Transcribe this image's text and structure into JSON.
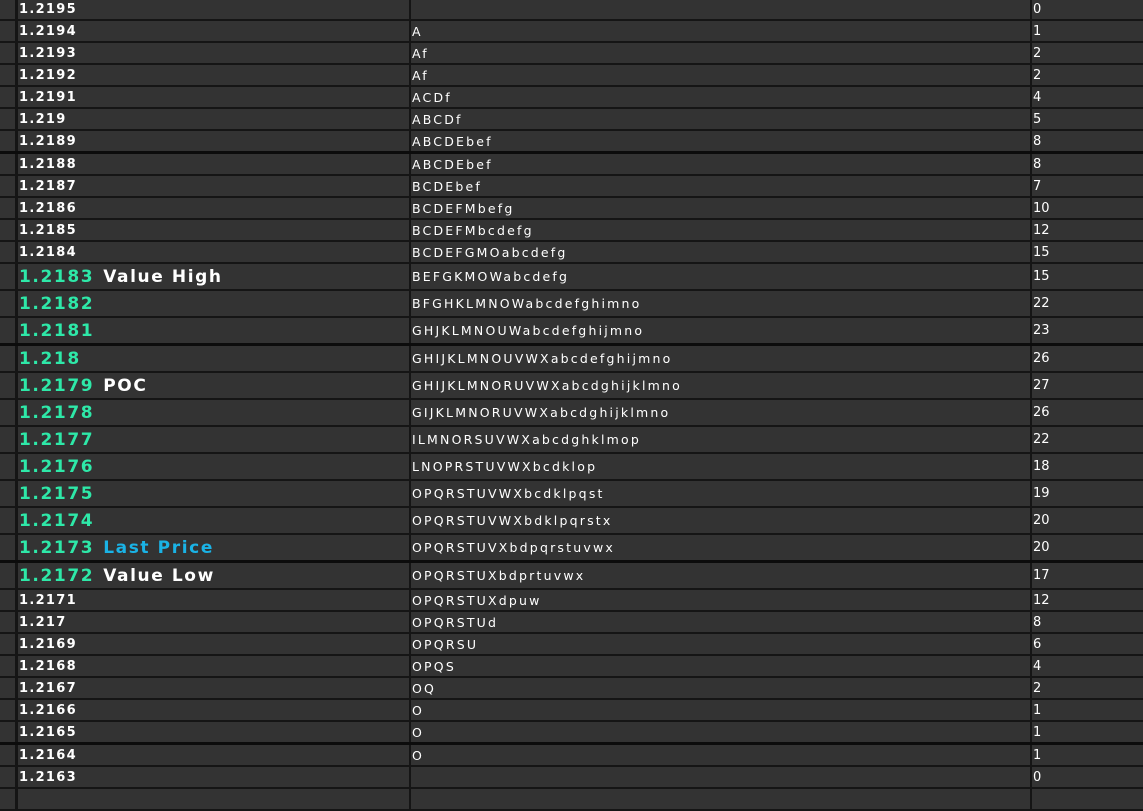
{
  "colors": {
    "background": "#333333",
    "grid": "#151515",
    "highlight_price": "#2ee8a8",
    "last_price_label": "#1ab3e6",
    "text": "#ffffff"
  },
  "rows": [
    {
      "price": "1.2195",
      "letters": "",
      "count": "0"
    },
    {
      "price": "1.2194",
      "letters": "A",
      "count": "1"
    },
    {
      "price": "1.2193",
      "letters": "Af",
      "count": "2"
    },
    {
      "price": "1.2192",
      "letters": "Af",
      "count": "2"
    },
    {
      "price": "1.2191",
      "letters": "ACDf",
      "count": "4"
    },
    {
      "price": "1.219",
      "letters": "ABCDf",
      "count": "5"
    },
    {
      "price": "1.2189",
      "letters": "ABCDEbef",
      "count": "8",
      "thick": true
    },
    {
      "price": "1.2188",
      "letters": "ABCDEbef",
      "count": "8"
    },
    {
      "price": "1.2187",
      "letters": "BCDEbef",
      "count": "7"
    },
    {
      "price": "1.2186",
      "letters": "BCDEFMbefg",
      "count": "10"
    },
    {
      "price": "1.2185",
      "letters": "BCDEFMbcdefg",
      "count": "12"
    },
    {
      "price": "1.2184",
      "letters": "BCDEFGMOabcdefg",
      "count": "15"
    },
    {
      "price": "1.2183",
      "label": "Value High",
      "letters": "BEFGKMOWabcdefg",
      "count": "15",
      "value_area": true
    },
    {
      "price": "1.2182",
      "letters": "BFGHKLMNOWabcdefghimno",
      "count": "22",
      "value_area": true
    },
    {
      "price": "1.2181",
      "letters": "GHJKLMNOUWabcdefghijmno",
      "count": "23",
      "value_area": true,
      "thick": true
    },
    {
      "price": "1.218",
      "letters": "GHIJKLMNOUVWXabcdefghijmno",
      "count": "26",
      "value_area": true
    },
    {
      "price": "1.2179",
      "label": "POC",
      "letters": "GHIJKLMNORUVWXabcdghijklmno",
      "count": "27",
      "value_area": true
    },
    {
      "price": "1.2178",
      "letters": "GIJKLMNORUVWXabcdghijklmno",
      "count": "26",
      "value_area": true
    },
    {
      "price": "1.2177",
      "letters": "ILMNORSUVWXabcdghklmop",
      "count": "22",
      "value_area": true
    },
    {
      "price": "1.2176",
      "letters": "LNOPRSTUVWXbcdklop",
      "count": "18",
      "value_area": true
    },
    {
      "price": "1.2175",
      "letters": "OPQRSTUVWXbcdklpqst",
      "count": "19",
      "value_area": true
    },
    {
      "price": "1.2174",
      "letters": "OPQRSTUVWXbdklpqrstx",
      "count": "20",
      "value_area": true
    },
    {
      "price": "1.2173",
      "label": "Last Price",
      "label_type": "last",
      "letters": "OPQRSTUVXbdpqrstuvwx",
      "count": "20",
      "value_area": true,
      "thick": true
    },
    {
      "price": "1.2172",
      "label": "Value Low",
      "letters": "OPQRSTUXbdprtuvwx",
      "count": "17",
      "value_area": true
    },
    {
      "price": "1.2171",
      "letters": "OPQRSTUXdpuw",
      "count": "12"
    },
    {
      "price": "1.217",
      "letters": "OPQRSTUd",
      "count": "8"
    },
    {
      "price": "1.2169",
      "letters": "OPQRSU",
      "count": "6"
    },
    {
      "price": "1.2168",
      "letters": "OPQS",
      "count": "4"
    },
    {
      "price": "1.2167",
      "letters": "OQ",
      "count": "2"
    },
    {
      "price": "1.2166",
      "letters": "O",
      "count": "1"
    },
    {
      "price": "1.2165",
      "letters": "O",
      "count": "1",
      "thick": true
    },
    {
      "price": "1.2164",
      "letters": "O",
      "count": "1"
    },
    {
      "price": "1.2163",
      "letters": "",
      "count": "0"
    },
    {
      "price": "",
      "letters": "",
      "count": ""
    }
  ]
}
